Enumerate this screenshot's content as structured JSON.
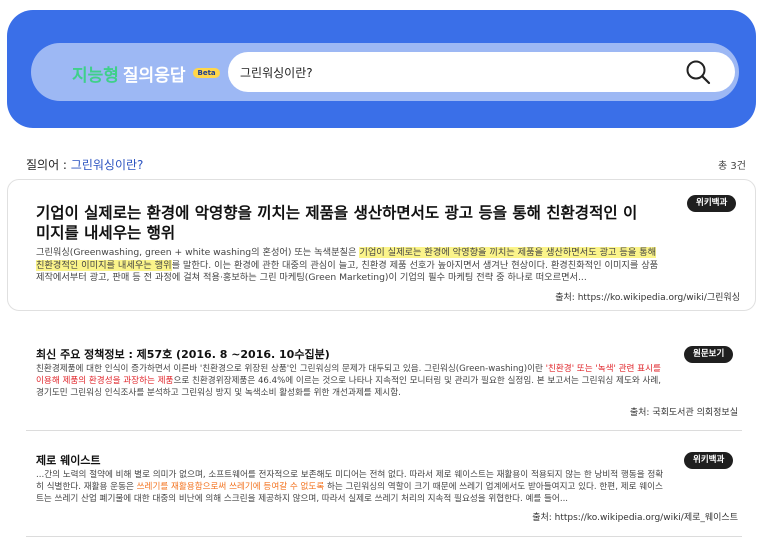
{
  "header": {
    "brand_part1": "지능형",
    "brand_part2": "질의응답",
    "beta_badge": "Beta",
    "search_value": "그린워싱이란?",
    "search_icon": "search-icon"
  },
  "query": {
    "label": "질의어 : ",
    "keyword": "그린워싱이란?",
    "total": "총 3건"
  },
  "featured": {
    "badge": "위키백과",
    "title": "기업이 실제로는 환경에 악영향을 끼치는 제품을 생산하면서도 광고 등을 통해 친환경적인 이미지를 내세우는 행위",
    "body_pre": "그린워싱(Greenwashing, green + white washing의 혼성어) 또는 녹색분칠은 ",
    "body_highlight": "기업이 실제로는 환경에 악영향을 끼치는 제품을 생산하면서도 광고 등을 통해 친환경적인 이미지를 내세우는 행위",
    "body_post": "를 말한다. 이는 환경에 관한 대중의 관심이 늘고, 친환경 제품 선호가 높아지면서 생겨난 현상이다. 환경친화적인 이미지를 상품 제작에서부터 광고, 판매 등 전 과정에 걸쳐 적용·홍보하는 그린 마케팅(Green Marketing)이 기업의 필수 마케팅 전략 중 하나로 떠오르면서...",
    "source": "출처: https://ko.wikipedia.org/wiki/그린워싱"
  },
  "results": [
    {
      "badge": "원문보기",
      "title": "최신 주요 정책정보 : 제57호 (2016. 8 ~2016. 10수집분)",
      "body_pre": "친환경제품에 대한 인식이 증가하면서 이른바 '친환경으로 위장된 상품'인 그린워싱의 문제가 대두되고 있음. 그린워싱(Green-washing)이란 ",
      "body_red": "'친환경' 또는 '녹색' 관련 표시를 이용해 제품의 환경성을 과장하는 제품",
      "body_post": "으로 친환경위장제품은 46.4%에 이르는 것으로 나타나 지속적인 모니터링 및 관리가 필요한 실정임. 본 보고서는 그린워싱 제도와 사례, 경기도민 그린워싱 인식조사를 분석하고 그린워싱 방지 및 녹색소비 활성화를 위한 개선과제를 제시함.",
      "source": "출처: 국회도서관 의회정보실"
    },
    {
      "badge": "위키백과",
      "title": "제로 웨이스트",
      "body_pre": "...간의 노력의 절약에 비해 별로 의미가 없으며, 소프트웨어를 전자적으로 보존해도 미디어는 전혀 없다. 따라서 제로 웨이스트는 재활용이 적용되지 않는 한 낭비적 행동을 정확히 식별한다. 재활용 운동은 ",
      "body_orange": "쓰레기를 재활용함으로써 쓰레기에 등여갈 수 없도록",
      "body_post": " 하는 그린워싱의 역할이 크기 때문에 쓰레기 업계에서도 받아들여지고 있다. 한편, 제로 웨이스트는 쓰레기 산업 폐기물에 대한 대중의 비난에 의해 스크린을 제공하지 않으며, 따라서 실제로 쓰레기 처리의 지속적 필요성을 위협한다. 예를 들어...",
      "source": "출처: https://ko.wikipedia.org/wiki/제로_웨이스트"
    }
  ]
}
